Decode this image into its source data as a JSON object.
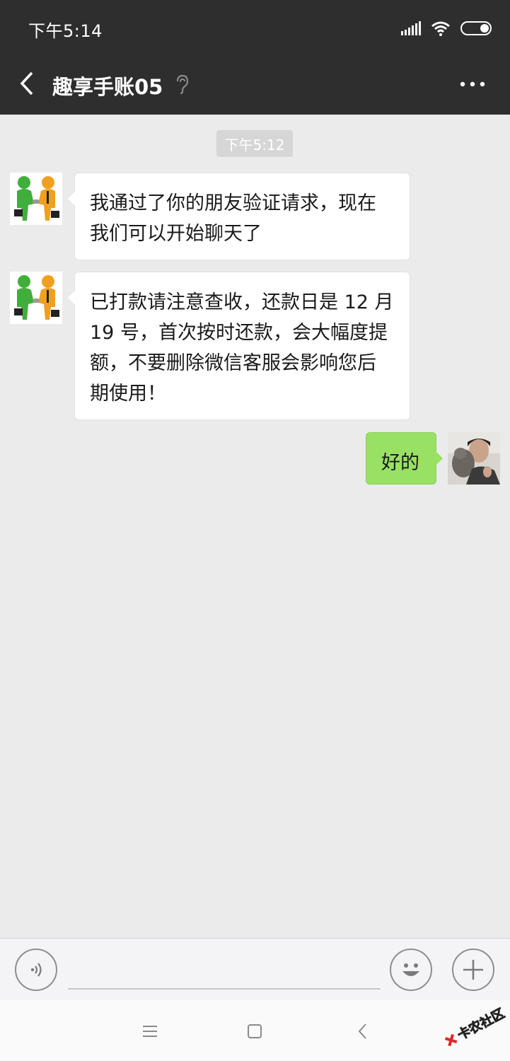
{
  "status_bar": {
    "time": "下午5:14"
  },
  "header": {
    "title": "趣享手账05"
  },
  "chat": {
    "timestamp": "下午5:12",
    "messages": [
      {
        "sender": "contact",
        "lines": [
          "我通过了你的朋友验证请求，现在",
          "我们可以开始聊天了"
        ]
      },
      {
        "sender": "contact",
        "lines": [
          "已打款请注意查收，还款日是 12 月",
          "19 号，首次按时还款，会大幅度提",
          "额，不要删除微信客服会影响您后",
          "期使用！"
        ]
      },
      {
        "sender": "me",
        "lines": [
          "好的"
        ]
      }
    ]
  },
  "input_bar": {
    "message_value": ""
  },
  "watermark": {
    "text": "卡农社区"
  },
  "colors": {
    "header_bg": "#2e2e2e",
    "chat_bg": "#ebebeb",
    "sent_bubble": "#98e165"
  },
  "icons": [
    "back-icon",
    "ear-icon",
    "more-icon",
    "voice-icon",
    "emoji-icon",
    "plus-icon",
    "menu-icon",
    "home-icon",
    "nav-back-icon"
  ]
}
